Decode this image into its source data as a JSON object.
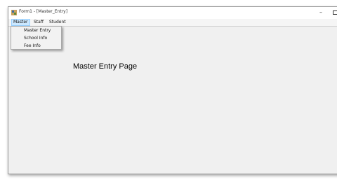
{
  "window": {
    "title": "Form1 - [Master_Entry]",
    "minimize_glyph": "–"
  },
  "menubar": {
    "items": [
      {
        "label": "Master"
      },
      {
        "label": "Staff"
      },
      {
        "label": "Student"
      }
    ]
  },
  "dropdown": {
    "items": [
      {
        "label": "Master Entry"
      },
      {
        "label": "School Info"
      },
      {
        "label": "Fee Info"
      }
    ]
  },
  "main": {
    "heading": "Master Entry Page"
  },
  "icons": {
    "app": "form-app-icon",
    "minimize": "minimize-icon",
    "maximize": "maximize-icon"
  }
}
